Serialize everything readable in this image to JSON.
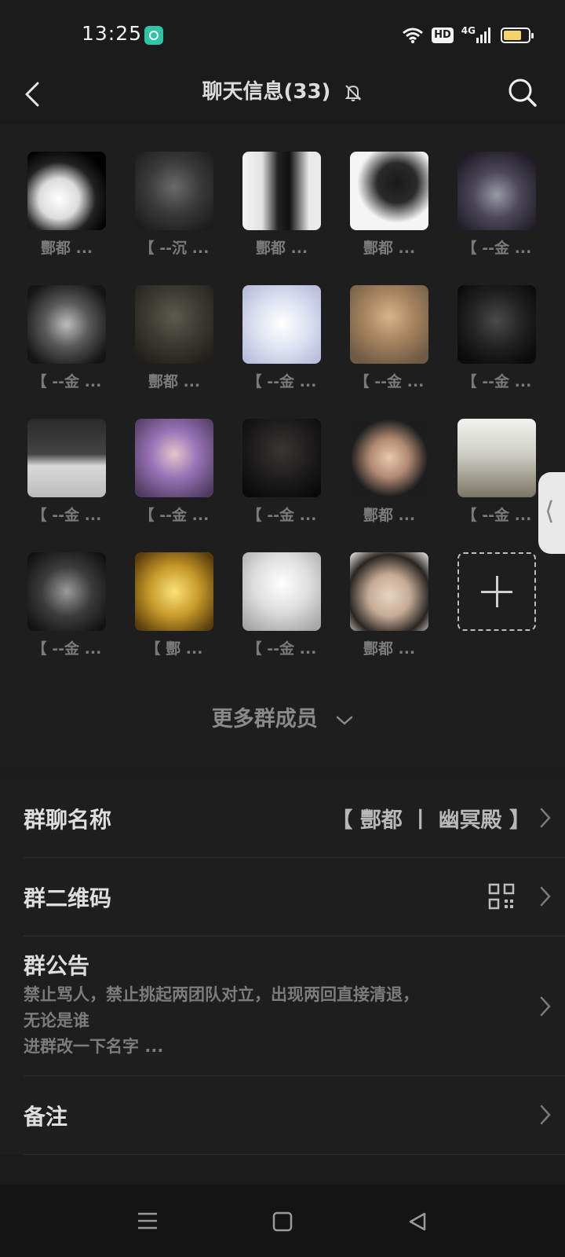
{
  "status": {
    "time": "13:25",
    "hd": "HD",
    "network": "4G"
  },
  "header": {
    "title": "聊天信息(33)",
    "icons": [
      "back-icon",
      "mute-bell-icon",
      "search-icon"
    ]
  },
  "members": [
    {
      "name": "酆都 ..."
    },
    {
      "name": "【 --沉 ..."
    },
    {
      "name": "酆都 ..."
    },
    {
      "name": "酆都 ..."
    },
    {
      "name": "【 --金 ..."
    },
    {
      "name": "【 --金 ..."
    },
    {
      "name": "酆都 ..."
    },
    {
      "name": "【 --金 ..."
    },
    {
      "name": "【 --金 ..."
    },
    {
      "name": "【 --金 ..."
    },
    {
      "name": "【 --金 ..."
    },
    {
      "name": "【 --金 ..."
    },
    {
      "name": "【 --金 ..."
    },
    {
      "name": "酆都 ..."
    },
    {
      "name": "【 --金 ..."
    },
    {
      "name": "【 --金 ..."
    },
    {
      "name": "【 酆 ..."
    },
    {
      "name": "【 --金 ..."
    },
    {
      "name": "酆都 ..."
    }
  ],
  "more_members": "更多群成员",
  "settings": {
    "group_name_label": "群聊名称",
    "group_name_value": "【 酆都 丨 幽冥殿 】",
    "qr_label": "群二维码",
    "notice_label": "群公告",
    "notice_line1": "禁止骂人，禁止挑起两团队对立，出现两回直接清退，",
    "notice_line2": "无论是谁",
    "notice_line3": "进群改一下名字 ...",
    "remark_label": "备注"
  },
  "colors": {
    "background": "#1e1e1e",
    "battery": "#f3d46a",
    "app_icon": "#2ec4a6"
  }
}
